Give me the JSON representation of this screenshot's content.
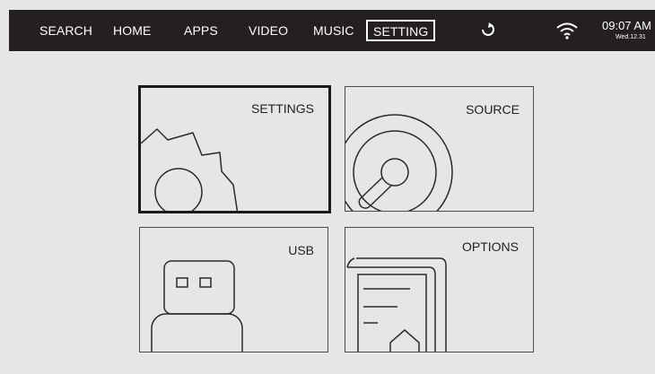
{
  "nav": {
    "items": [
      {
        "label": "SEARCH"
      },
      {
        "label": "HOME"
      },
      {
        "label": "APPS"
      },
      {
        "label": "VIDEO"
      },
      {
        "label": "MUSIC"
      },
      {
        "label": "SETTING",
        "active": true
      }
    ]
  },
  "status": {
    "time": "09:07 AM",
    "date": "Wed.12.31",
    "wifi_icon": "wifi-icon",
    "cursor_icon": "pointer-icon"
  },
  "tiles": [
    {
      "label": "SETTINGS",
      "icon": "gear-icon",
      "selected": true
    },
    {
      "label": "SOURCE",
      "icon": "disc-icon"
    },
    {
      "label": "USB",
      "icon": "usb-icon"
    },
    {
      "label": "OPTIONS",
      "icon": "document-icon"
    }
  ],
  "colors": {
    "topbar": "#241f20",
    "background": "#e6e6e6",
    "line": "#2a2a2a"
  }
}
